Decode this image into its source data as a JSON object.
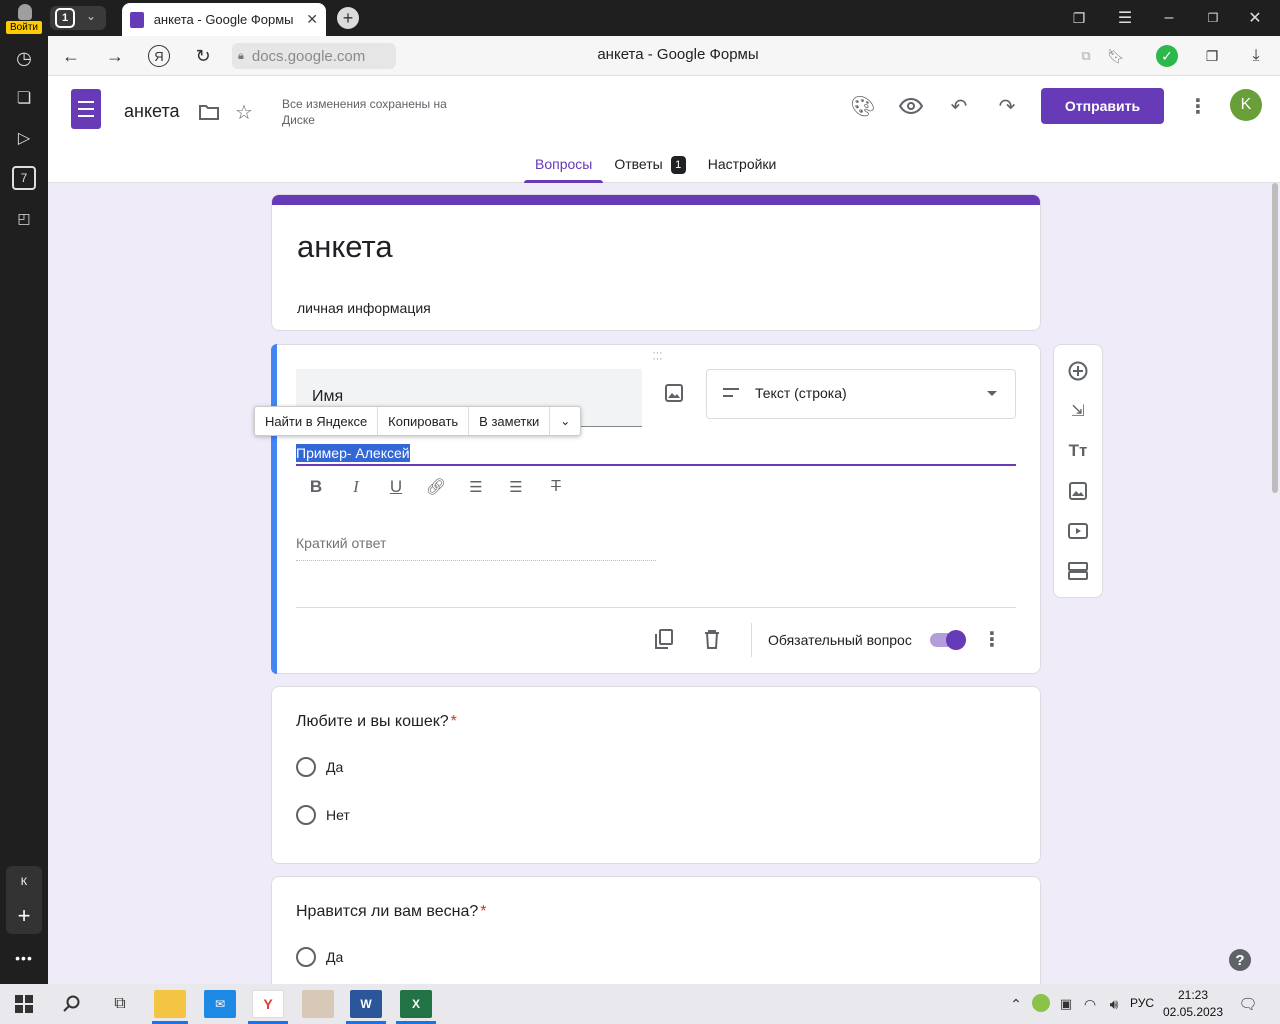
{
  "browser": {
    "profile_label": "Войти",
    "tab_counter": "1",
    "active_tab_title": "анкета - Google Формы",
    "url": "docs.google.com",
    "page_title": "анкета - Google Формы",
    "sidebar_profile_letter": "К"
  },
  "app": {
    "form_name": "анкета",
    "save_status": "Все изменения сохранены на Диске",
    "send_label": "Отправить",
    "avatar_letter": "K",
    "tabs": [
      {
        "label": "Вопросы"
      },
      {
        "label": "Ответы"
      },
      {
        "label": "Настройки"
      }
    ],
    "responses_count": "1"
  },
  "form": {
    "title": "анкета",
    "description": "личная информация"
  },
  "question1": {
    "title": "Имя",
    "type_label": "Текст (строка)",
    "description_selected": "Пример- Алексей",
    "answer_placeholder": "Краткий ответ",
    "required_label": "Обязательный вопрос",
    "required": true
  },
  "context_menu": {
    "items": [
      {
        "label": "Найти в Яндексе"
      },
      {
        "label": "Копировать"
      },
      {
        "label": "В заметки"
      }
    ]
  },
  "question2": {
    "title": "Любите и вы кошек?",
    "required_mark": "*",
    "options": [
      {
        "label": "Да"
      },
      {
        "label": "Нет"
      }
    ]
  },
  "question3": {
    "title": "Нравится ли вам весна?",
    "required_mark": "*",
    "options": [
      {
        "label": "Да"
      }
    ]
  },
  "taskbar": {
    "language": "РУС",
    "time": "21:23",
    "date": "02.05.2023"
  },
  "colors": {
    "accent": "#673ab7",
    "focus_bar": "#4285f4",
    "background": "#f0ebf8"
  }
}
